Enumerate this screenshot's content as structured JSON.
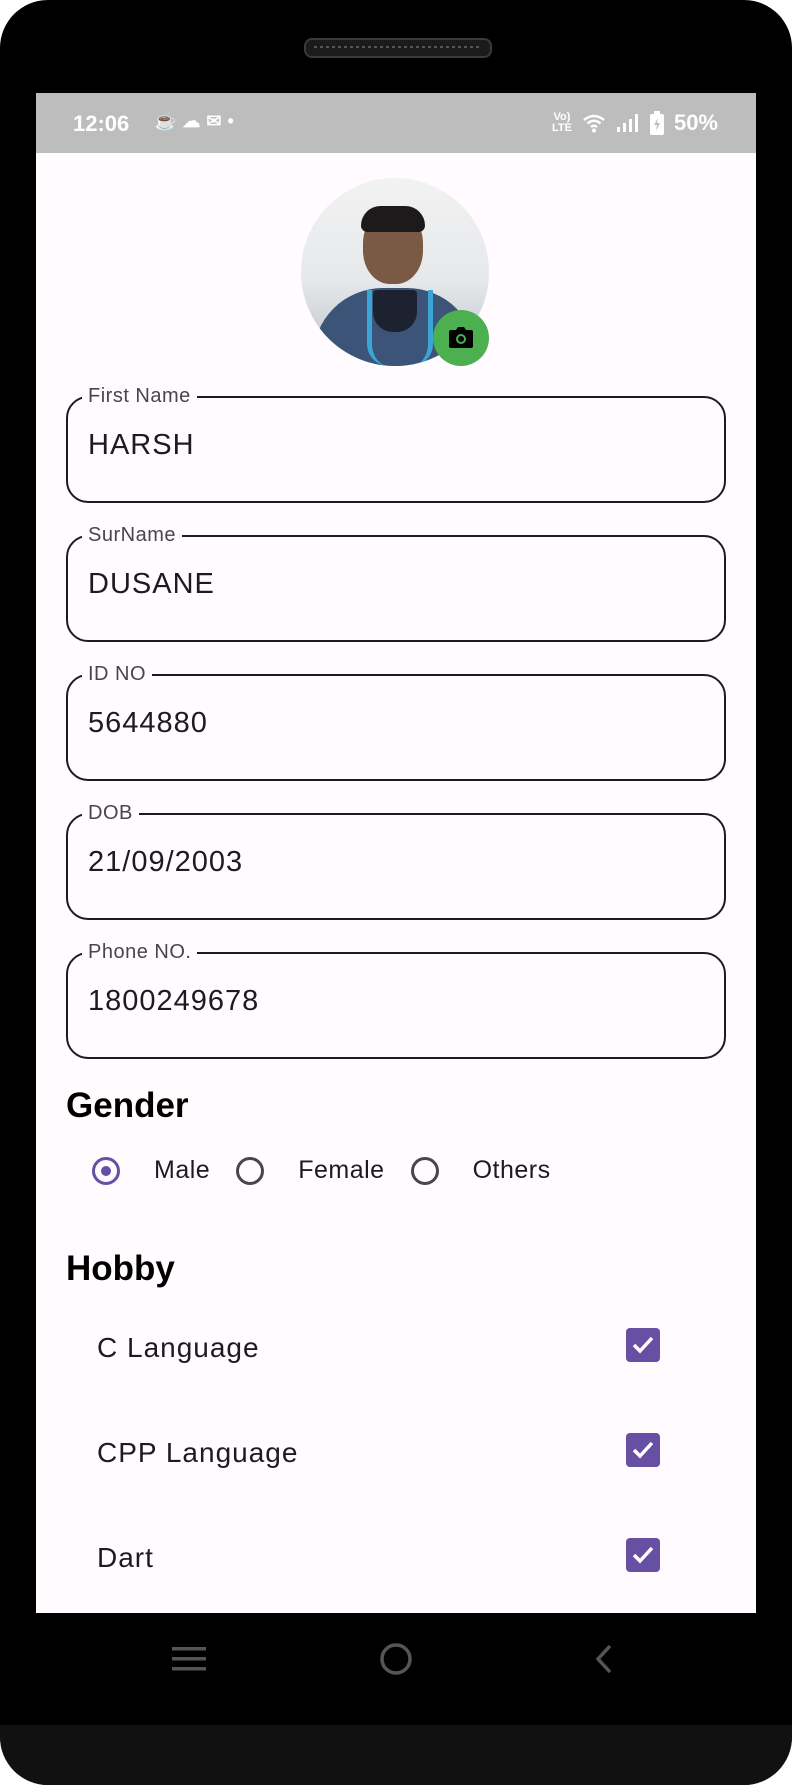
{
  "status_bar": {
    "time": "12:06",
    "battery": "50%",
    "network_badge_top": "Vo)",
    "network_badge_bottom": "LTE"
  },
  "profile": {
    "photo": "profile-photo",
    "camera_button_icon": "camera-icon",
    "accent_color": "#4caf50"
  },
  "form": {
    "first_name": {
      "label": "First Name",
      "value": "HARSH"
    },
    "surname": {
      "label": "SurName",
      "value": "DUSANE"
    },
    "id_no": {
      "label": "ID NO",
      "value": "5644880"
    },
    "dob": {
      "label": "DOB",
      "value": "21/09/2003"
    },
    "phone": {
      "label": "Phone NO.",
      "value": "1800249678"
    }
  },
  "gender": {
    "title": "Gender",
    "options": [
      {
        "label": "Male",
        "selected": true
      },
      {
        "label": "Female",
        "selected": false
      },
      {
        "label": "Others",
        "selected": false
      }
    ]
  },
  "hobby": {
    "title": "Hobby",
    "items": [
      {
        "label": "C Language",
        "checked": true
      },
      {
        "label": "CPP Language",
        "checked": true
      },
      {
        "label": "Dart",
        "checked": true
      }
    ]
  },
  "theme": {
    "primary": "#6750a4",
    "background": "#fffbfe",
    "status_bar": "#bdbdbd"
  },
  "navigation": {
    "icons": [
      "menu-icon",
      "home-icon",
      "back-icon"
    ]
  }
}
